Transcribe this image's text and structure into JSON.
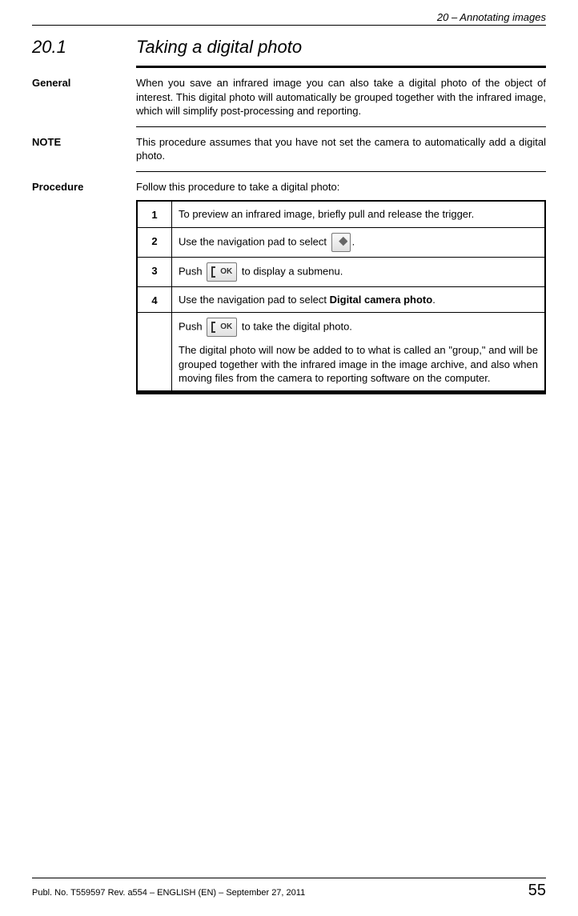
{
  "header": {
    "chapter": "20 – Annotating images"
  },
  "section": {
    "number": "20.1",
    "title": "Taking a digital photo"
  },
  "general": {
    "label": "General",
    "text": "When you save an infrared image you can also take a digital photo of the object of interest. This digital photo will automatically be grouped together with the infrared image, which will simplify post-processing and reporting."
  },
  "note": {
    "label": "NOTE",
    "text": "This procedure assumes that you have not set the camera to automatically add a digital photo."
  },
  "procedure": {
    "label": "Procedure",
    "intro": "Follow this procedure to take a digital photo:",
    "steps": [
      {
        "n": "1",
        "text": "To preview an infrared image, briefly pull and release the trigger."
      },
      {
        "n": "2",
        "pre": "Use the navigation pad to select ",
        "icon": "diamond",
        "post": "."
      },
      {
        "n": "3",
        "pre": "Push ",
        "icon": "ok",
        "post": " to display a submenu."
      },
      {
        "n": "4",
        "pre": "Use the navigation pad to select ",
        "bold": "Digital camera photo",
        "post2": "."
      },
      {
        "n": "",
        "pre": "Push ",
        "icon": "ok",
        "post": " to take the digital photo.",
        "para2": "The digital photo will now be added to to what is called an \"group,\" and will be grouped together with the infrared image in the image archive, and also when moving files from the camera to reporting software on the computer."
      }
    ]
  },
  "footer": {
    "pub": "Publ. No. T559597 Rev. a554 – ENGLISH (EN) – September 27, 2011",
    "page": "55"
  }
}
